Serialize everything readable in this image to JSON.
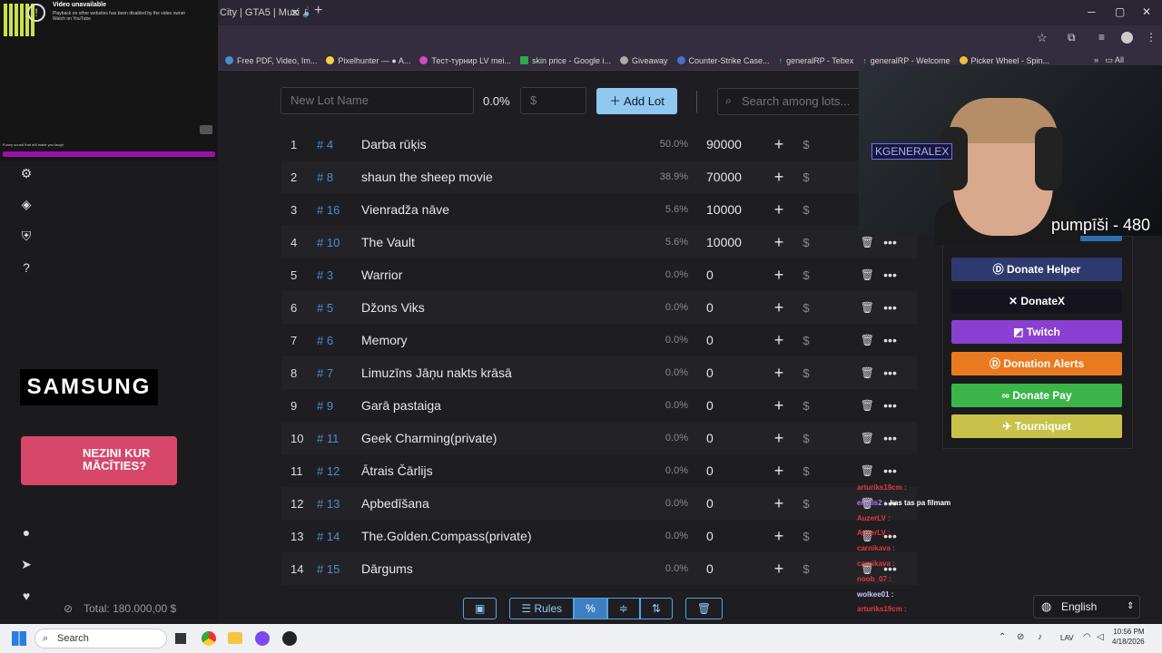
{
  "browser": {
    "active_tab": "City | GTA5 | Musi",
    "bookmarks": [
      "Free PDF, Video, Im...",
      "Pixelhunter — ● A...",
      "Тест-турнир LV mei...",
      "skin price - Google i...",
      "Giveaway",
      "Counter-Strike Case...",
      "generalRP - Tebex",
      "generalRP - Welcome",
      "Picker Wheel - Spin..."
    ],
    "all_bookmarks": "All Bookmarks"
  },
  "video": {
    "title": "Video unavailable",
    "message": "Playback on other websites has been disabled by the video owner",
    "link": "Watch on YouTube",
    "caption": "Funny sound that will make you laugh"
  },
  "sidebar": {
    "samsung": "SAMSUNG",
    "promo": "NEZINI KUR MĀCĪTIES?",
    "total": "Total: 180.000,00 $"
  },
  "toolbar": {
    "lot_name_placeholder": "New Lot Name",
    "percent": "0.0%",
    "dollar_placeholder": "$",
    "add_lot": "Add Lot",
    "search_placeholder": "Search among lots..."
  },
  "lots": [
    {
      "idx": "1",
      "id": "# 4",
      "name": "Darba rūķis",
      "pct": "50.0%",
      "amount": "90000"
    },
    {
      "idx": "2",
      "id": "# 8",
      "name": "shaun the sheep movie",
      "pct": "38.9%",
      "amount": "70000"
    },
    {
      "idx": "3",
      "id": "# 16",
      "name": "Vienradža nāve",
      "pct": "5.6%",
      "amount": "10000"
    },
    {
      "idx": "4",
      "id": "# 10",
      "name": "The Vault",
      "pct": "5.6%",
      "amount": "10000"
    },
    {
      "idx": "5",
      "id": "# 3",
      "name": "Warrior",
      "pct": "0.0%",
      "amount": "0"
    },
    {
      "idx": "6",
      "id": "# 5",
      "name": "Džons Viks",
      "pct": "0.0%",
      "amount": "0"
    },
    {
      "idx": "7",
      "id": "# 6",
      "name": "Memory",
      "pct": "0.0%",
      "amount": "0"
    },
    {
      "idx": "8",
      "id": "# 7",
      "name": "Limuzīns Jāņu nakts krāsā",
      "pct": "0.0%",
      "amount": "0"
    },
    {
      "idx": "9",
      "id": "# 9",
      "name": "Garā pastaiga",
      "pct": "0.0%",
      "amount": "0"
    },
    {
      "idx": "10",
      "id": "# 11",
      "name": "Geek Charming(private)",
      "pct": "0.0%",
      "amount": "0"
    },
    {
      "idx": "11",
      "id": "# 12",
      "name": "Ātrais Čārlijs",
      "pct": "0.0%",
      "amount": "0"
    },
    {
      "idx": "12",
      "id": "# 13",
      "name": "Apbedīšana",
      "pct": "0.0%",
      "amount": "0"
    },
    {
      "idx": "13",
      "id": "# 14",
      "name": "The.Golden.Compass(private)",
      "pct": "0.0%",
      "amount": "0"
    },
    {
      "idx": "14",
      "id": "# 15",
      "name": "Dārgums",
      "pct": "0.0%",
      "amount": "0"
    }
  ],
  "bottom": {
    "rules": "Rules"
  },
  "donate": {
    "helper": "Donate Helper",
    "donatex": "DonateX",
    "twitch": "Twitch",
    "alerts": "Donation Alerts",
    "pay": "Donate Pay",
    "tourniquet": "Tourniquet",
    "colors": {
      "helper": "#2e3a6e",
      "donatex": "#15131f",
      "twitch": "#8a3fd0",
      "alerts": "#ea7a1f",
      "pay": "#3bb54a",
      "tourniquet": "#c9c24a"
    }
  },
  "webcam": {
    "tag": "KGENERALEX",
    "overlay": "pumpīši - 480"
  },
  "chat": [
    {
      "user": "arturiks19cm :",
      "color": "#e03a3a",
      "msg": ""
    },
    {
      "user": "endiis2 :",
      "color": "#b57cff",
      "msg": "kas tas pa filmam"
    },
    {
      "user": "AuzerLV :",
      "color": "#e03a3a",
      "msg": ""
    },
    {
      "user": "AuzerLV :",
      "color": "#e03a3a",
      "msg": ""
    },
    {
      "user": "carnikava :",
      "color": "#e03a3a",
      "msg": ""
    },
    {
      "user": "carnikava :",
      "color": "#e03a3a",
      "msg": ""
    },
    {
      "user": "noob_07 :",
      "color": "#e03a3a",
      "msg": ""
    },
    {
      "user": "wolkee01 :",
      "color": "#c8c8ff",
      "msg": ""
    },
    {
      "user": "arturiks19cm :",
      "color": "#e03a3a",
      "msg": ""
    }
  ],
  "language": "English",
  "taskbar": {
    "search": "Search",
    "lang": "LAV",
    "time": "10:56 PM",
    "date": "4/18/2026"
  }
}
